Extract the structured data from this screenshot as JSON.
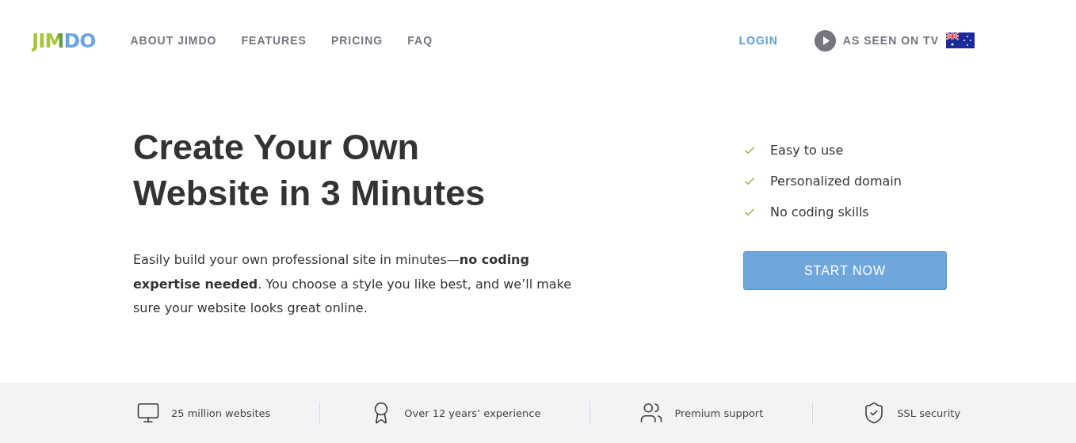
{
  "header": {
    "logo": "JIMDO",
    "nav": [
      {
        "label": "ABOUT JIMDO"
      },
      {
        "label": "FEATURES"
      },
      {
        "label": "PRICING"
      },
      {
        "label": "FAQ"
      }
    ],
    "login": "LOGIN",
    "tv": "AS SEEN ON TV"
  },
  "hero": {
    "title": "Create Your Own Website in 3 Minutes",
    "text": "Easily build your own professional site in minutes—**no coding expertise needed**. You choose a style you like best, and we’ll make sure your website looks great online.",
    "benefits": [
      "Easy to use",
      "Personalized domain",
      "No coding skills"
    ],
    "cta": "START NOW"
  },
  "features": [
    {
      "kind": "websites",
      "label": "25 million websites"
    },
    {
      "kind": "experience",
      "label": "Over 12 years’ experience"
    },
    {
      "kind": "support",
      "label": "Premium support"
    },
    {
      "kind": "security",
      "label": "SSL security"
    }
  ]
}
